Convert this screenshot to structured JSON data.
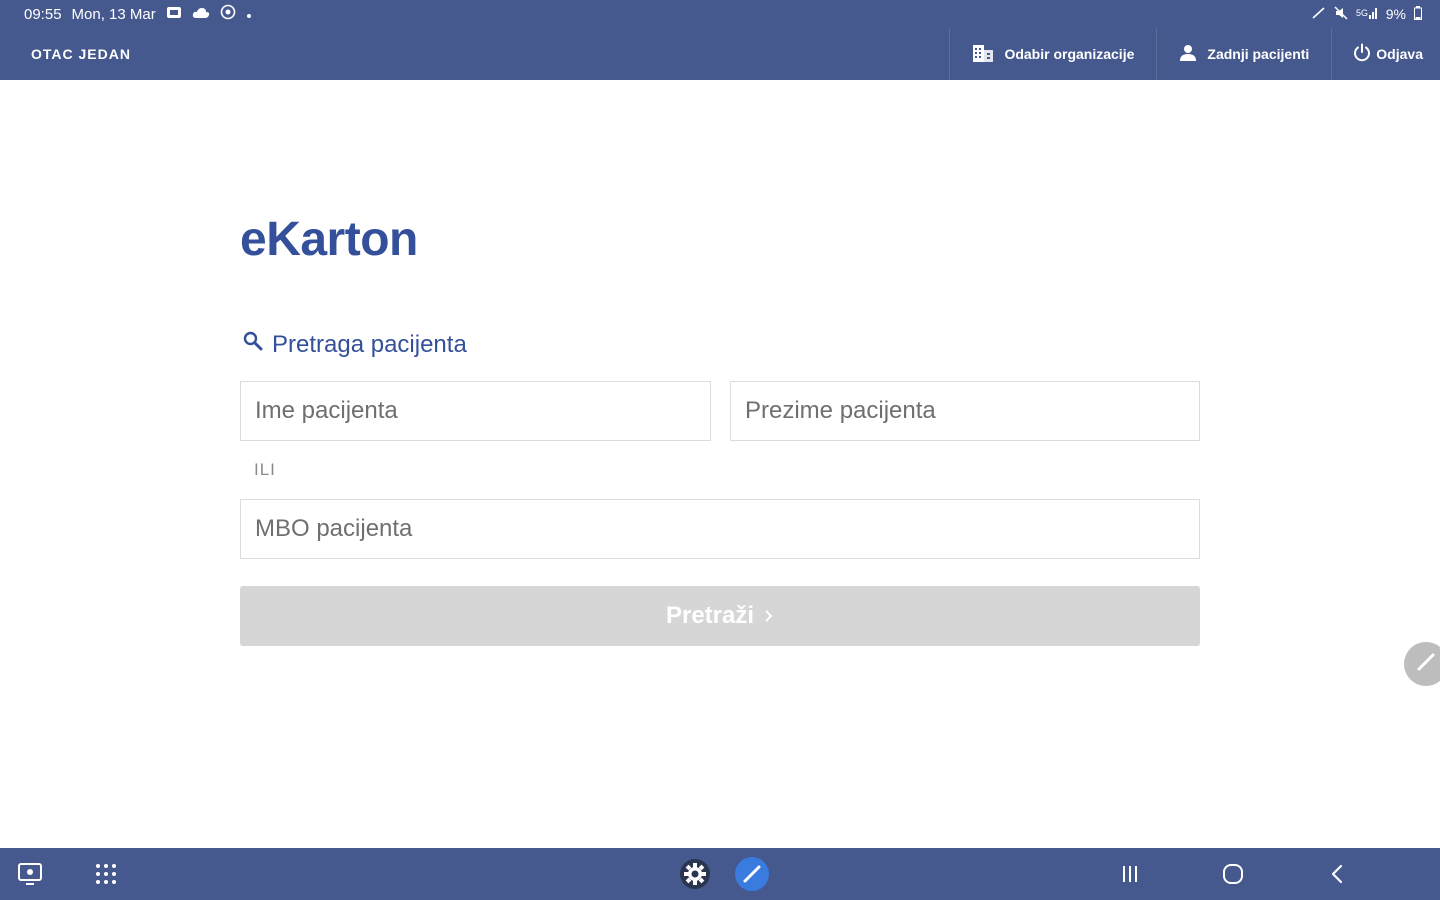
{
  "status_bar": {
    "time": "09:55",
    "date": "Mon, 13 Mar",
    "battery": "9%",
    "icons": [
      "notification-icon",
      "cloud-icon",
      "vpn-icon",
      "dot-icon",
      "stylus-icon",
      "mute-icon",
      "signal-icon",
      "battery-icon"
    ]
  },
  "app_bar": {
    "user_name": "OTAC JEDAN",
    "actions": [
      {
        "label": "Odabir organizacije",
        "icon": "building-icon"
      },
      {
        "label": "Zadnji pacijenti",
        "icon": "person-icon"
      },
      {
        "label": "Odjava",
        "icon": "power-icon"
      }
    ]
  },
  "main": {
    "brand": "eKarton",
    "search_title": "Pretraga pacijenta",
    "first_name_placeholder": "Ime pacijenta",
    "last_name_placeholder": "Prezime pacijenta",
    "or_label": "ILI",
    "mbo_placeholder": "MBO pacijenta",
    "search_button": "Pretraži"
  },
  "nav_bar": {
    "icons": [
      "screenshot-icon",
      "apps-grid-icon",
      "settings-icon",
      "pen-app-icon",
      "recents-icon",
      "home-icon",
      "back-icon"
    ]
  },
  "colors": {
    "primary": "#46598f",
    "brand_text": "#34509a",
    "button_disabled": "#d6d6d6"
  }
}
